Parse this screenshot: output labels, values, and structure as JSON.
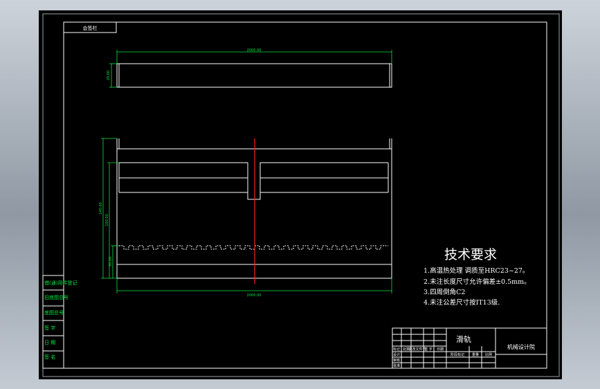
{
  "drawing": {
    "top_left_label": "会签栏",
    "tech_title": "技术要求",
    "tech_notes": [
      "1.高温热处理 调质至HRC23~27。",
      "2.未注长度尺寸允许偏差±0.5mm。",
      "3.四周倒角C2",
      "4.未注公差尺寸按IT13级."
    ],
    "dimensions": {
      "top_overall": "2000.00",
      "top_height": "20.00",
      "front_total": "140.00",
      "front_mid": "100.00",
      "front_lower": "30.00",
      "bottom_overall": "2000.00"
    },
    "left_column": [
      "借(通)用件登记",
      "旧底图总号",
      "底图总号",
      "签 字",
      "日 期",
      "签 名"
    ],
    "title_block": {
      "part_name": "滑轨",
      "company": "机械设计院",
      "header_cells": [
        "标记",
        "处数",
        "更改文件号",
        "签 字",
        "日期"
      ],
      "cells": [
        "设计",
        "审核",
        "批准",
        "阶段标记",
        "重量",
        "比例"
      ]
    },
    "colors": {
      "background": "#000000",
      "lines": "#ffffff",
      "dimensions": "#00e640",
      "centerline": "#ff2020",
      "frame": "#9aa3ad"
    }
  }
}
